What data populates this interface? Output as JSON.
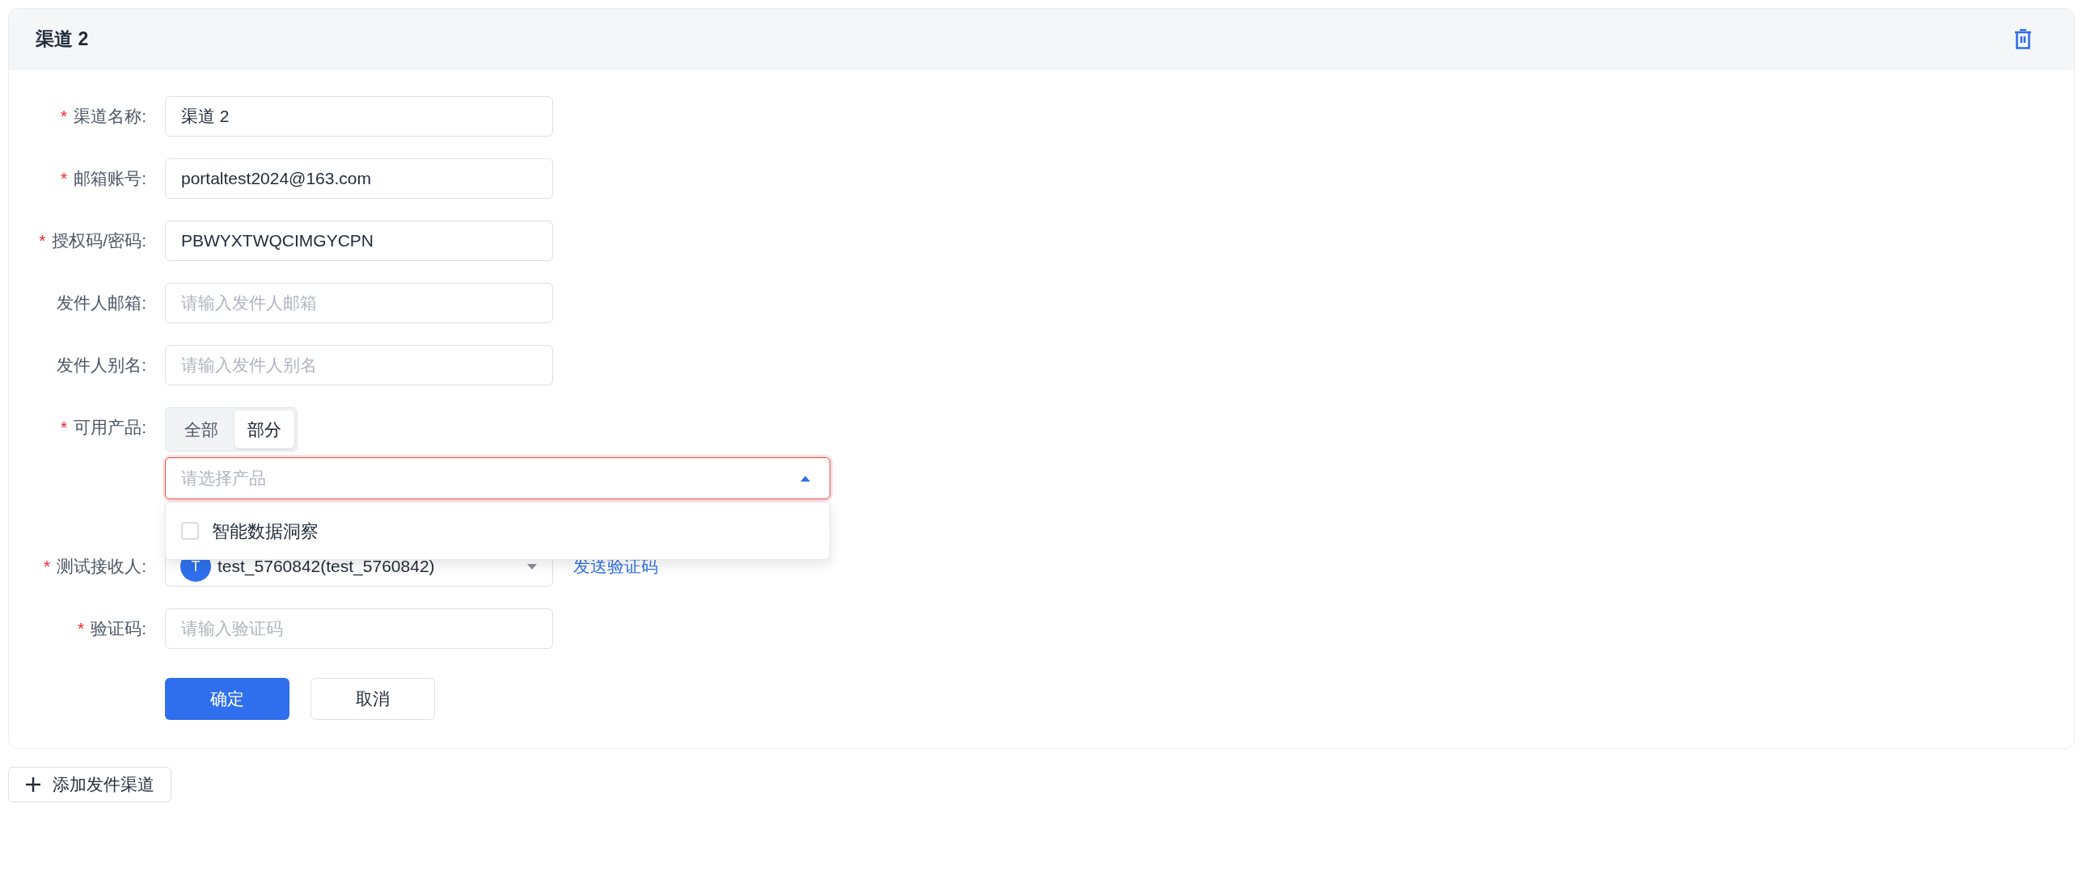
{
  "card": {
    "title": "渠道 2"
  },
  "fields": [
    {
      "kind": "input",
      "required_mark": "*",
      "label": "渠道名称:",
      "value": "渠道 2"
    },
    {
      "kind": "input",
      "required_mark": "*",
      "label": "邮箱账号:",
      "value": "portaltest2024@163.com"
    },
    {
      "kind": "input",
      "required_mark": "*",
      "label": "授权码/密码:",
      "value": "PBWYXTWQCIMGYCPN"
    },
    {
      "kind": "input",
      "label": "发件人邮箱:",
      "placeholder": "请输入发件人邮箱"
    },
    {
      "kind": "input",
      "label": "发件人别名:",
      "placeholder": "请输入发件人别名"
    },
    {
      "kind": "segmented",
      "required_mark": "*",
      "label": "可用产品:",
      "options": [
        {
          "label": "全部",
          "selected": false
        },
        {
          "label": "部分",
          "selected": true
        }
      ],
      "select": {
        "placeholder": "请选择产品",
        "expanded": true,
        "invalid": true,
        "options": [
          {
            "label": "智能数据洞察",
            "checked": false
          }
        ]
      }
    },
    {
      "kind": "user-select",
      "required_mark": "*",
      "label": "测试接收人:",
      "avatar": "T",
      "value": "test_5760842(test_5760842)",
      "link": "发送验证码"
    },
    {
      "kind": "input",
      "required_mark": "*",
      "label": "验证码:",
      "placeholder": "请输入验证码"
    }
  ],
  "buttons": [
    {
      "label": "确定",
      "primary": true
    },
    {
      "label": "取消",
      "primary": false
    }
  ],
  "add_button": {
    "label": "添加发件渠道"
  }
}
